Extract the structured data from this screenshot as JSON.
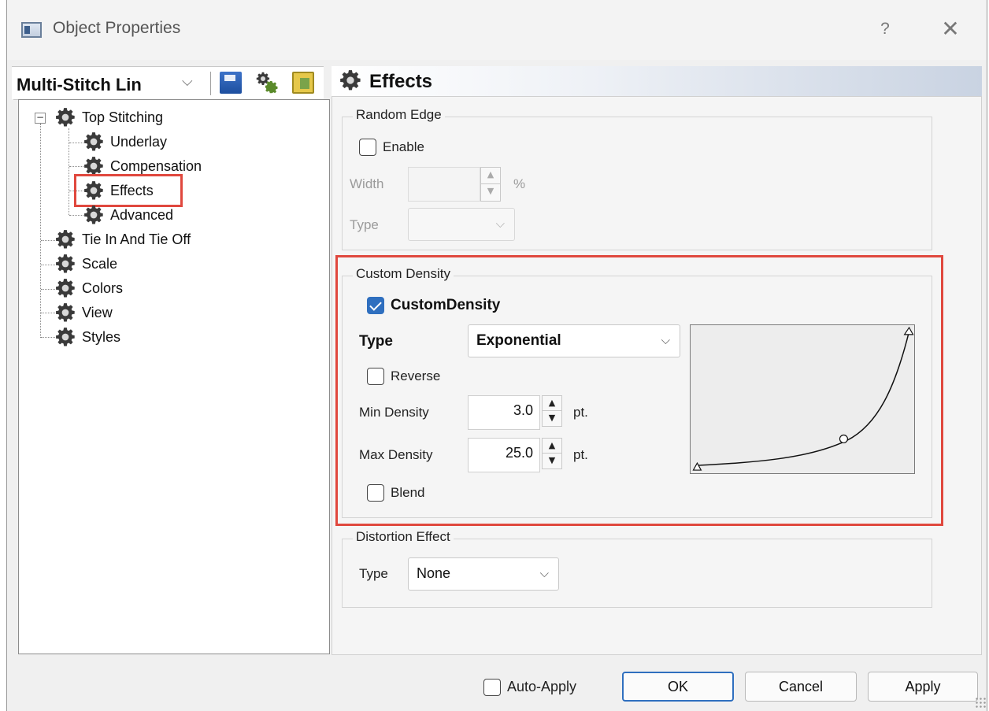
{
  "window": {
    "title": "Object Properties",
    "help_label": "?",
    "close_label": "✕"
  },
  "left_pane": {
    "combo_value": "Multi-Stitch Lin",
    "toolbar_icons": [
      "save-icon",
      "gears-icon",
      "clipboard-icon"
    ],
    "tree": [
      {
        "label": "Top Stitching",
        "expanded": true,
        "expander": "−"
      },
      {
        "label": "Underlay"
      },
      {
        "label": "Compensation"
      },
      {
        "label": "Effects",
        "selected": true
      },
      {
        "label": "Advanced"
      },
      {
        "label": "Tie In And Tie Off"
      },
      {
        "label": "Scale"
      },
      {
        "label": "Colors"
      },
      {
        "label": "View"
      },
      {
        "label": "Styles"
      }
    ]
  },
  "panel": {
    "title": "Effects",
    "random_edge": {
      "group_label": "Random Edge",
      "enable_label": "Enable",
      "enable_checked": false,
      "width_label": "Width",
      "width_value": "",
      "width_unit": "%",
      "type_label": "Type",
      "type_value": ""
    },
    "custom_density": {
      "group_label": "Custom Density",
      "checkbox_label": "CustomDensity",
      "checked": true,
      "type_label": "Type",
      "type_value": "Exponential",
      "reverse_label": "Reverse",
      "reverse_checked": false,
      "min_label": "Min Density",
      "min_value": "3.0",
      "max_label": "Max Density",
      "max_value": "25.0",
      "unit": "pt.",
      "blend_label": "Blend",
      "blend_checked": false
    },
    "distortion": {
      "group_label": "Distortion Effect",
      "type_label": "Type",
      "type_value": "None"
    }
  },
  "footer": {
    "auto_apply_label": "Auto-Apply",
    "auto_apply_checked": false,
    "ok_label": "OK",
    "cancel_label": "Cancel",
    "apply_label": "Apply"
  },
  "colors": {
    "highlight_red": "#e0483e",
    "accent_blue": "#2f6fbf"
  }
}
